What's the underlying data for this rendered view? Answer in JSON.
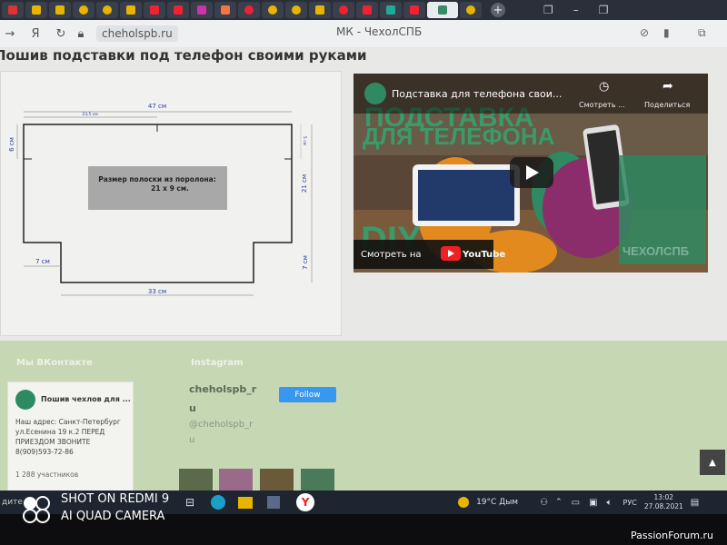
{
  "browser": {
    "url": "cheholspb.ru",
    "page_title": "МК - ЧехолСПБ"
  },
  "page": {
    "heading": "Пошив подставки под телефон своими руками"
  },
  "diagram": {
    "top_width": "47 см",
    "inner_top": "23,5 см",
    "left_height": "6 см",
    "right_small": "5 см",
    "right_height": "21 см",
    "bottom_left": "7 см",
    "bottom_right": "7 см",
    "bottom_width": "33 см",
    "note_line1": "Размер полоски из поролона:",
    "note_line2": "21 х 9 см."
  },
  "video": {
    "title": "Подставка для телефона свои...",
    "watch_later": "Смотреть ...",
    "share": "Поделиться",
    "watch_on": "Смотреть на",
    "youtube": "YouTube",
    "overlay_line1": "ПОДСТАВКА",
    "overlay_line2": "ДЛЯ ТЕЛЕФОНА",
    "diy": "DIY",
    "brand": "ЧЕХОЛСПБ"
  },
  "footer": {
    "vk_heading": "Мы ВКонтакте",
    "vk_group": "Пошив чехлов для ...",
    "vk_address": "Наш адрес: Санкт-Петербург ул.Есенина 19 к.2 ПЕРЕД ПРИЕЗДОМ ЗВОНИТЕ 8(909)593-72-86",
    "vk_members": "1 288 участников",
    "ig_heading": "Instagram",
    "ig_user": "cheholspb_r",
    "ig_user2": "u",
    "ig_handle": "@cheholspb_r",
    "ig_handle2": "u",
    "follow": "Follow"
  },
  "taskbar": {
    "weather": "19°C  Дым",
    "lang": "РУС",
    "time": "13:02",
    "date": "27.08.2021",
    "left_text": "дите"
  },
  "watermarks": {
    "shot_on": "SHOT ON REDMI 9",
    "camera": "AI QUAD CAMERA",
    "forum": "PassionForum.ru"
  },
  "colors": {
    "follow_button": "#3897f0",
    "footer_bg": "#c6d7b4",
    "tab_bar": "#2b2f3a"
  }
}
